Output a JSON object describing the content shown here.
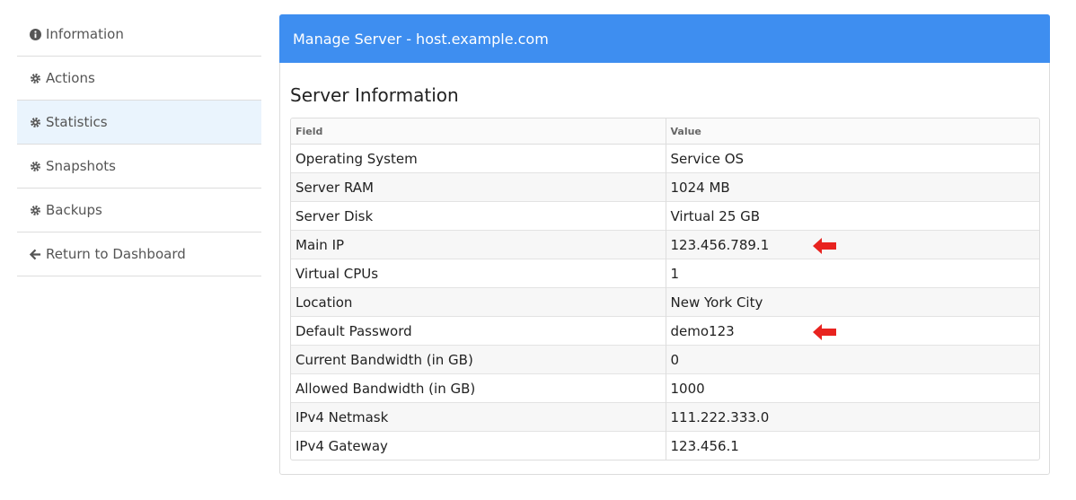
{
  "sidebar": {
    "items": [
      {
        "label": "Information",
        "icon": "info-icon",
        "active": false
      },
      {
        "label": "Actions",
        "icon": "gear-icon",
        "active": false
      },
      {
        "label": "Statistics",
        "icon": "gear-icon",
        "active": true
      },
      {
        "label": "Snapshots",
        "icon": "gear-icon",
        "active": false
      },
      {
        "label": "Backups",
        "icon": "gear-icon",
        "active": false
      },
      {
        "label": "Return to Dashboard",
        "icon": "arrow-left-icon",
        "active": false
      }
    ]
  },
  "panel": {
    "title": "Manage Server - host.example.com",
    "section_title": "Server Information",
    "columns": [
      "Field",
      "Value"
    ],
    "rows": [
      {
        "field": "Operating System",
        "value": "Service OS"
      },
      {
        "field": "Server RAM",
        "value": "1024 MB"
      },
      {
        "field": "Server Disk",
        "value": "Virtual 25 GB"
      },
      {
        "field": "Main IP",
        "value": "123.456.789.1"
      },
      {
        "field": "Virtual CPUs",
        "value": "1"
      },
      {
        "field": "Location",
        "value": "New York City"
      },
      {
        "field": "Default Password",
        "value": "demo123"
      },
      {
        "field": "Current Bandwidth (in GB)",
        "value": "0"
      },
      {
        "field": "Allowed Bandwidth (in GB)",
        "value": "1000"
      },
      {
        "field": "IPv4 Netmask",
        "value": "111.222.333.0"
      },
      {
        "field": "IPv4 Gateway",
        "value": "123.456.1"
      }
    ]
  },
  "colors": {
    "header": "#3e8ef0",
    "active_item": "#eaf4fd",
    "arrow": "#e8231f"
  }
}
